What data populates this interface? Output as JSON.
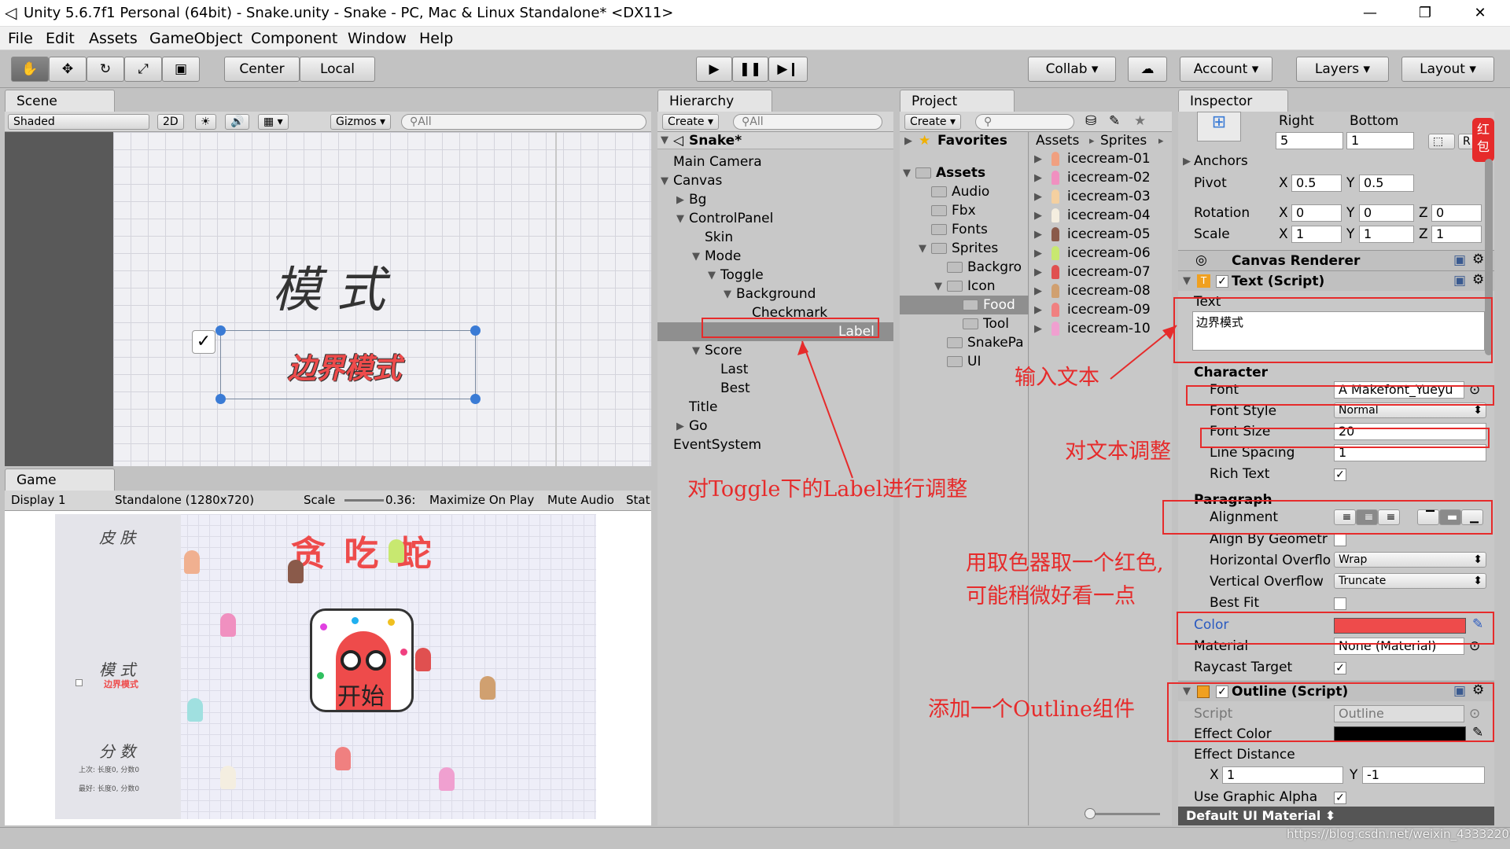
{
  "window": {
    "title": "Unity 5.6.7f1 Personal (64bit) - Snake.unity - Snake - PC, Mac & Linux Standalone* <DX11>",
    "minimize": "—",
    "restore": "❐",
    "close": "✕"
  },
  "menu": [
    "File",
    "Edit",
    "Assets",
    "GameObject",
    "Component",
    "Window",
    "Help"
  ],
  "toolbar": {
    "center": "Center",
    "local": "Local",
    "collab": "Collab",
    "account": "Account",
    "layers": "Layers",
    "layout": "Layout"
  },
  "scene": {
    "tab": "Scene",
    "shaded": "Shaded",
    "mode2d": "2D",
    "gizmos": "Gizmos",
    "search": "All",
    "title_text": "模 式",
    "label_text": "边界模式"
  },
  "game": {
    "tab": "Game",
    "display": "Display 1",
    "resolution": "Standalone (1280x720)",
    "scale_label": "Scale",
    "scale_value": "0.36:",
    "maximize": "Maximize On Play",
    "mute": "Mute Audio",
    "stats": "Stat",
    "skin": "皮 肤",
    "title": "贪 吃 蛇",
    "mode": "模 式",
    "mode_label": "边界模式",
    "score": "分 数",
    "last": "上次: 长度0, 分数0",
    "best": "最好: 长度0, 分数0",
    "start": "开始"
  },
  "hierarchy": {
    "tab": "Hierarchy",
    "create": "Create",
    "search": "All",
    "scene": "Snake*",
    "items": [
      {
        "label": "Main Camera",
        "indent": 1,
        "arrow": ""
      },
      {
        "label": "Canvas",
        "indent": 1,
        "arrow": "▼"
      },
      {
        "label": "Bg",
        "indent": 2,
        "arrow": "▶"
      },
      {
        "label": "ControlPanel",
        "indent": 2,
        "arrow": "▼"
      },
      {
        "label": "Skin",
        "indent": 3,
        "arrow": ""
      },
      {
        "label": "Mode",
        "indent": 3,
        "arrow": "▼"
      },
      {
        "label": "Toggle",
        "indent": 4,
        "arrow": "▼"
      },
      {
        "label": "Background",
        "indent": 5,
        "arrow": "▼"
      },
      {
        "label": "Checkmark",
        "indent": 6,
        "arrow": ""
      },
      {
        "label": "Label",
        "indent": 5,
        "arrow": "",
        "selected": true
      },
      {
        "label": "Score",
        "indent": 3,
        "arrow": "▼"
      },
      {
        "label": "Last",
        "indent": 4,
        "arrow": ""
      },
      {
        "label": "Best",
        "indent": 4,
        "arrow": ""
      },
      {
        "label": "Title",
        "indent": 2,
        "arrow": ""
      },
      {
        "label": "Go",
        "indent": 2,
        "arrow": "▶"
      },
      {
        "label": "EventSystem",
        "indent": 1,
        "arrow": ""
      }
    ]
  },
  "project": {
    "tab": "Project",
    "create": "Create",
    "favorites": "Favorites",
    "breadcrumb": [
      "Assets",
      "Sprites"
    ],
    "tree": [
      {
        "label": "Assets",
        "indent": 0,
        "arrow": "▼",
        "bold": true
      },
      {
        "label": "Audio",
        "indent": 1,
        "arrow": ""
      },
      {
        "label": "Fbx",
        "indent": 1,
        "arrow": ""
      },
      {
        "label": "Fonts",
        "indent": 1,
        "arrow": ""
      },
      {
        "label": "Sprites",
        "indent": 1,
        "arrow": "▼"
      },
      {
        "label": "Backgro",
        "indent": 2,
        "arrow": ""
      },
      {
        "label": "Icon",
        "indent": 2,
        "arrow": "▼"
      },
      {
        "label": "Food",
        "indent": 3,
        "arrow": "",
        "selected": true
      },
      {
        "label": "Tool",
        "indent": 3,
        "arrow": ""
      },
      {
        "label": "SnakePa",
        "indent": 2,
        "arrow": ""
      },
      {
        "label": "UI",
        "indent": 2,
        "arrow": ""
      }
    ],
    "assets": [
      "icecream-01",
      "icecream-02",
      "icecream-03",
      "icecream-04",
      "icecream-05",
      "icecream-06",
      "icecream-07",
      "icecream-08",
      "icecream-09",
      "icecream-10"
    ]
  },
  "inspector": {
    "tab": "Inspector",
    "right_label": "Right",
    "bottom_label": "Bottom",
    "right_value": "5",
    "bottom_value": "1",
    "anchors": "Anchors",
    "pivot": "Pivot",
    "pivot_x": "0.5",
    "pivot_y": "0.5",
    "rotation": "Rotation",
    "rot_x": "0",
    "rot_y": "0",
    "rot_z": "0",
    "scale": "Scale",
    "scale_x": "1",
    "scale_y": "1",
    "scale_z": "1",
    "canvas_renderer": "Canvas Renderer",
    "text_script": "Text (Script)",
    "text_label": "Text",
    "text_value": "边界模式",
    "character": "Character",
    "font": "Font",
    "font_value": "Makefont_Yueyu",
    "font_style": "Font Style",
    "font_style_value": "Normal",
    "font_size": "Font Size",
    "font_size_value": "20",
    "line_spacing": "Line Spacing",
    "line_spacing_value": "1",
    "rich_text": "Rich Text",
    "paragraph": "Paragraph",
    "alignment": "Alignment",
    "align_by_geometry": "Align By Geometr",
    "horizontal_overflow": "Horizontal Overflo",
    "horizontal_value": "Wrap",
    "vertical_overflow": "Vertical Overflow",
    "vertical_value": "Truncate",
    "best_fit": "Best Fit",
    "color": "Color",
    "color_value": "#ee4b4b",
    "material": "Material",
    "material_value": "None (Material)",
    "raycast_target": "Raycast Target",
    "outline_script": "Outline (Script)",
    "script_label": "Script",
    "script_value": "Outline",
    "effect_color": "Effect Color",
    "effect_distance": "Effect Distance",
    "ed_x": "1",
    "ed_y": "-1",
    "use_graphic_alpha": "Use Graphic Alpha",
    "default_material": "Default UI Material",
    "redpacket": "红包"
  },
  "annotations": {
    "input_text": "输入文本",
    "adjust_text": "对文本调整",
    "toggle_label": "对Toggle下的Label进行调整",
    "color_pick_1": "用取色器取一个红色,",
    "color_pick_2": "可能稍微好看一点",
    "add_outline": "添加一个Outline组件"
  },
  "watermark": "https://blog.csdn.net/weixin_43332204",
  "colors": {
    "accent_red": "#e62b2b",
    "label_red": "#ee4b4b",
    "selection": "#8f8f8f",
    "panel": "#c2c2c2"
  }
}
